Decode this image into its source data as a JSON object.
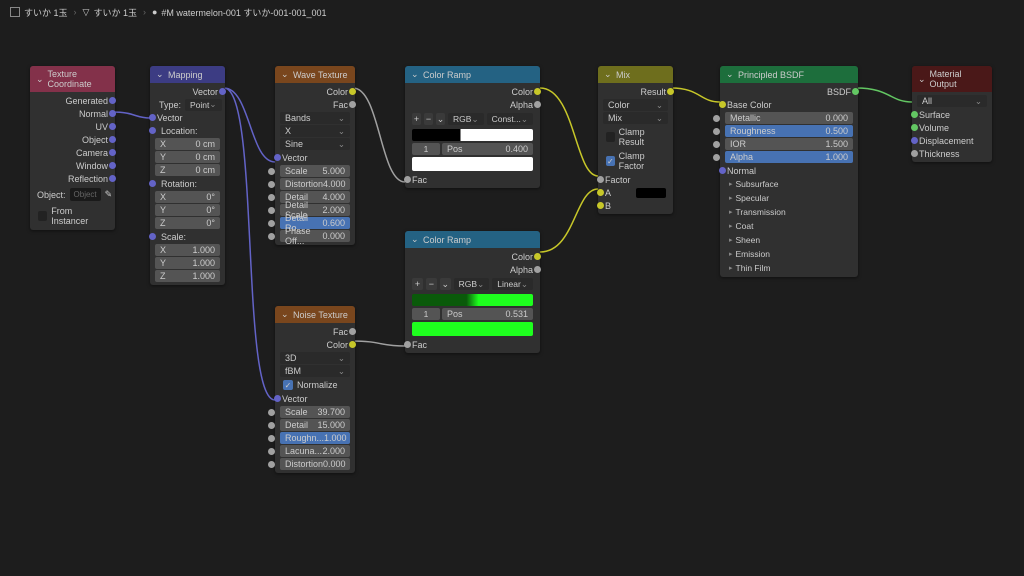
{
  "breadcrumb": {
    "a": "すいか 1玉",
    "b": "すいか 1玉",
    "c": "#M watermelon-001 すいか-001-001_001"
  },
  "texcoord": {
    "title": "Texture Coordinate",
    "outs": [
      "Generated",
      "Normal",
      "UV",
      "Object",
      "Camera",
      "Window",
      "Reflection"
    ],
    "object_label": "Object:",
    "object_placeholder": "Object",
    "from_instancer": "From Instancer"
  },
  "mapping": {
    "title": "Mapping",
    "out": "Vector",
    "type_label": "Type:",
    "type_val": "Point",
    "vec_in": "Vector",
    "loc": "Location:",
    "rot": "Rotation:",
    "scale": "Scale:",
    "loc_x": "0 cm",
    "loc_y": "0 cm",
    "loc_z": "0 cm",
    "rot_x": "0°",
    "rot_y": "0°",
    "rot_z": "0°",
    "sc_x": "1.000",
    "sc_y": "1.000",
    "sc_z": "1.000"
  },
  "wave": {
    "title": "Wave Texture",
    "out_color": "Color",
    "out_fac": "Fac",
    "bands": "Bands",
    "x": "X",
    "sine": "Sine",
    "vec": "Vector",
    "props": [
      {
        "k": "Scale",
        "v": "5.000"
      },
      {
        "k": "Distortion",
        "v": "4.000"
      },
      {
        "k": "Detail",
        "v": "4.000"
      },
      {
        "k": "Detail Scale",
        "v": "2.000"
      },
      {
        "k": "Detail Ro...",
        "v": "0.600",
        "blue": true
      },
      {
        "k": "Phase Off...",
        "v": "0.000"
      }
    ]
  },
  "noise": {
    "title": "Noise Texture",
    "out_fac": "Fac",
    "out_color": "Color",
    "d3": "3D",
    "fbm": "fBM",
    "normalize": "Normalize",
    "vec": "Vector",
    "props": [
      {
        "k": "Scale",
        "v": "39.700"
      },
      {
        "k": "Detail",
        "v": "15.000"
      },
      {
        "k": "Roughn...",
        "v": "1.000",
        "blue": true
      },
      {
        "k": "Lacuna...",
        "v": "2.000"
      },
      {
        "k": "Distortion",
        "v": "0.000"
      }
    ]
  },
  "ramp1": {
    "title": "Color Ramp",
    "out_color": "Color",
    "out_alpha": "Alpha",
    "mode_a": "RGB",
    "mode_b": "Const...",
    "idx": "1",
    "pos_label": "Pos",
    "pos_val": "0.400",
    "fac": "Fac",
    "grad": "linear-gradient(90deg,#000 0%,#000 40%,#fff 40%,#fff 100%)",
    "swatch": "#ffffff"
  },
  "ramp2": {
    "title": "Color Ramp",
    "out_color": "Color",
    "out_alpha": "Alpha",
    "mode_a": "RGB",
    "mode_b": "Linear",
    "idx": "1",
    "pos_label": "Pos",
    "pos_val": "0.531",
    "fac": "Fac",
    "grad": "linear-gradient(90deg,#0a5a0a 0%,#0a5a0a 45%,#1eff1e 55%,#1eff1e 100%)",
    "swatch": "#1eff1e"
  },
  "mix": {
    "title": "Mix",
    "out": "Result",
    "type_color": "Color",
    "blend": "Mix",
    "clamp_result": "Clamp Result",
    "clamp_factor": "Clamp Factor",
    "factor": "Factor",
    "a": "A",
    "b": "B",
    "a_swatch": "#000000"
  },
  "bsdf": {
    "title": "Principled BSDF",
    "out": "BSDF",
    "base": "Base Color",
    "props": [
      {
        "k": "Metallic",
        "v": "0.000"
      },
      {
        "k": "Roughness",
        "v": "0.500",
        "blue": true
      },
      {
        "k": "IOR",
        "v": "1.500"
      },
      {
        "k": "Alpha",
        "v": "1.000",
        "blue": true
      }
    ],
    "normal": "Normal",
    "exp": [
      "Subsurface",
      "Specular",
      "Transmission",
      "Coat",
      "Sheen",
      "Emission",
      "Thin Film"
    ]
  },
  "output": {
    "title": "Material Output",
    "target": "All",
    "ins": [
      "Surface",
      "Volume",
      "Displacement",
      "Thickness"
    ]
  }
}
